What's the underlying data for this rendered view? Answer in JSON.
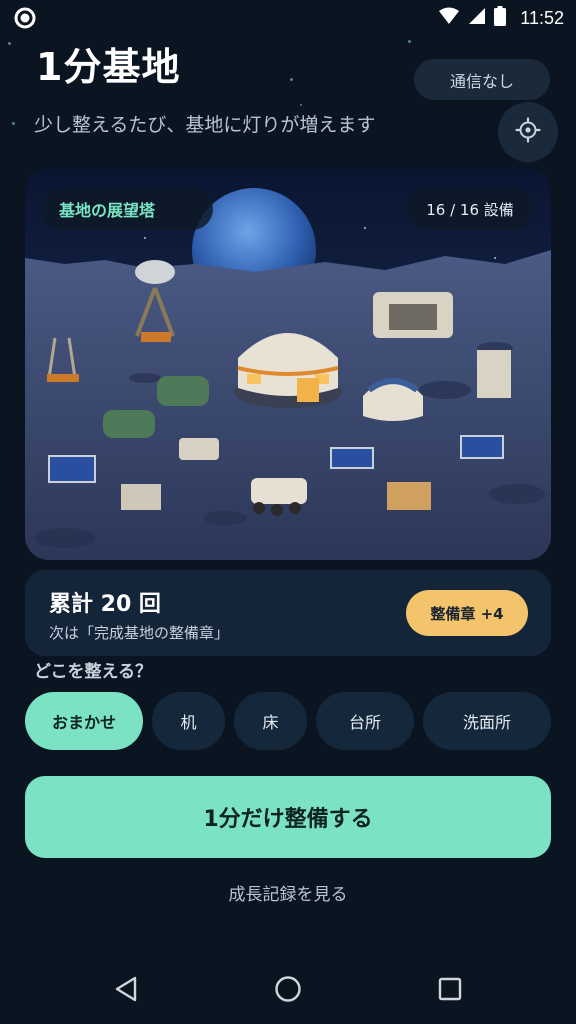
{
  "status_bar": {
    "time": "11:52"
  },
  "header": {
    "title": "1分基地",
    "subtitle": "少し整えるたび、基地に灯りが増えます",
    "offline_label": "通信なし"
  },
  "hero": {
    "location_label": "基地の展望塔",
    "equipment_count": "16 / 16 設備"
  },
  "progress": {
    "total_label": "累計 20 回",
    "next_label": "次は「完成基地の整備章」",
    "badge_label": "整備章 +4"
  },
  "areas": {
    "question": "どこを整える？",
    "options": [
      "おまかせ",
      "机",
      "床",
      "台所",
      "洗面所"
    ],
    "selected": "おまかせ"
  },
  "actions": {
    "primary_label": "1分だけ整備する",
    "history_label": "成長記録を見る"
  },
  "colors": {
    "background": "#0a1521",
    "accent": "#7be3c4",
    "badge": "#f3c46b",
    "card": "#14253a"
  },
  "icons": {
    "settings": "gear-icon",
    "back": "back-triangle-icon",
    "home": "home-circle-icon",
    "recents": "recents-square-icon"
  }
}
